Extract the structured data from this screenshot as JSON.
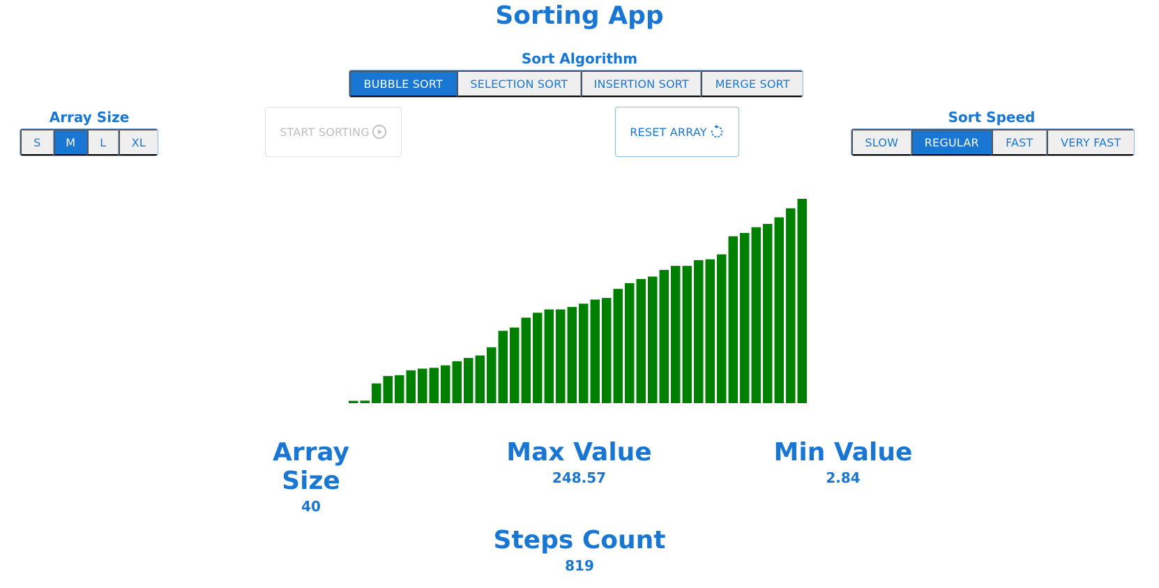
{
  "app": {
    "title": "Sorting App"
  },
  "algorithm": {
    "label": "Sort Algorithm",
    "options": [
      "BUBBLE SORT",
      "SELECTION SORT",
      "INSERTION SORT",
      "MERGE SORT"
    ],
    "selected": "BUBBLE SORT"
  },
  "array_size": {
    "label": "Array Size",
    "options": [
      "S",
      "M",
      "L",
      "XL"
    ],
    "selected": "M"
  },
  "speed": {
    "label": "Sort Speed",
    "options": [
      "SLOW",
      "REGULAR",
      "FAST",
      "VERY FAST"
    ],
    "selected": "REGULAR"
  },
  "actions": {
    "start_label": "START SORTING",
    "start_icon": "play-circle-icon",
    "reset_label": "RESET ARRAY",
    "reset_icon": "refresh-icon"
  },
  "stats": {
    "array_size_label": "Array Size",
    "array_size_value": "40",
    "max_label": "Max Value",
    "max_value": "248.57",
    "min_label": "Min Value",
    "min_value": "2.84",
    "steps_label": "Steps Count",
    "steps_value": "819"
  },
  "colors": {
    "accent": "#1976d2",
    "bar": "#008000",
    "disabled": "#bdbdbd"
  },
  "chart_data": {
    "type": "bar",
    "values": [
      2.84,
      3.1,
      24,
      33,
      34,
      40,
      42,
      43,
      46,
      51,
      55,
      58,
      68,
      88,
      92,
      104,
      110,
      114,
      114,
      117,
      121,
      126,
      128,
      139,
      146,
      151,
      154,
      162,
      167,
      167,
      174,
      175,
      181,
      203,
      207,
      214,
      218,
      226,
      237,
      248.57
    ],
    "ylim": [
      0,
      248.57
    ]
  }
}
